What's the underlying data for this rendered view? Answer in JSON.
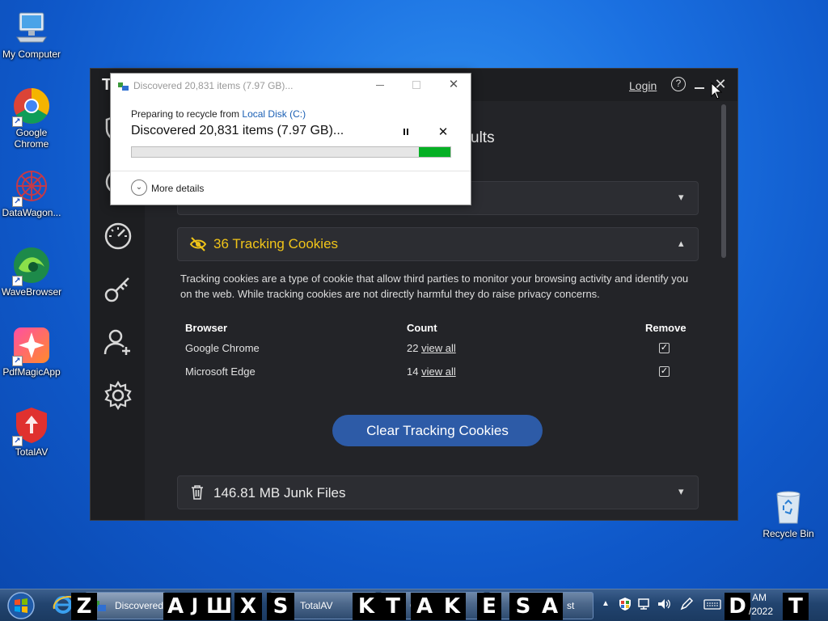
{
  "desktop": {
    "icons": [
      {
        "label": "My Computer"
      },
      {
        "label": "Google Chrome"
      },
      {
        "label": "DataWagon..."
      },
      {
        "label": "WaveBrowser"
      },
      {
        "label": "PdfMagicApp"
      },
      {
        "label": "TotalAV"
      }
    ],
    "recycle_bin": "Recycle Bin"
  },
  "totalav": {
    "logo_letter": "T",
    "login": "Login",
    "help_glyph": "?",
    "heading_fragment": "ults",
    "tracking_section": {
      "title": "36 Tracking Cookies",
      "description": "Tracking cookies are a type of cookie that allow third parties to monitor your browsing activity and identify you on the web. While tracking cookies are not directly harmful they do raise privacy concerns.",
      "columns": {
        "browser": "Browser",
        "count": "Count",
        "remove": "Remove"
      },
      "rows": [
        {
          "browser": "Google Chrome",
          "count": "22",
          "link": "view all",
          "checked": true
        },
        {
          "browser": "Microsoft Edge",
          "count": "14",
          "link": "view all",
          "checked": true
        }
      ],
      "clear_button": "Clear Tracking Cookies"
    },
    "junk_section": {
      "title": "146.81 MB Junk Files"
    }
  },
  "progress_dialog": {
    "title": "Discovered 20,831 items (7.97 GB)...",
    "preparing_prefix": "Preparing to recycle from ",
    "source": "Local Disk (C:)",
    "status": "Discovered 20,831 items (7.97 GB)...",
    "progress_fraction": 0.1,
    "more_details": "More details"
  },
  "taskbar": {
    "buttons": [
      {
        "label": "Discovered"
      },
      {
        "label": "TotalAV"
      },
      {
        "label": "G"
      },
      {
        "label": "st"
      }
    ],
    "osk_keys": [
      "Z",
      "A",
      "J",
      "Ш",
      "X",
      "S",
      "K",
      "T",
      "A",
      "K",
      "E",
      "S",
      "A",
      "D",
      "T"
    ],
    "clock_time": "AM",
    "clock_date": "/2022"
  },
  "colors": {
    "accent_yellow": "#f0c419",
    "button_blue": "#2d5ba7",
    "progress_green": "#06b025",
    "window_bg": "#232428"
  }
}
